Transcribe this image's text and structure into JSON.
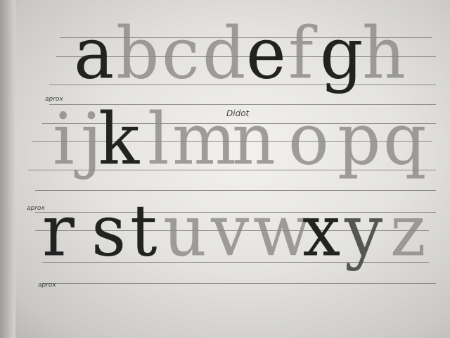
{
  "rows": [
    {
      "letters": [
        "a",
        "b",
        "c",
        "d",
        "e",
        "f",
        "g",
        "h"
      ],
      "shading": [
        "dark",
        "light",
        "light",
        "light",
        "dark",
        "light",
        "dark",
        "light"
      ]
    },
    {
      "letters": [
        "i",
        "j",
        "k",
        "l",
        "m",
        "n",
        "o",
        "p",
        "q"
      ],
      "shading": [
        "light",
        "light",
        "dark",
        "light",
        "light",
        "light",
        "light",
        "light",
        "light"
      ]
    },
    {
      "letters": [
        "r",
        "s",
        "t",
        "u",
        "v",
        "w",
        "x",
        "y",
        "z"
      ],
      "shading": [
        "dark",
        "dark",
        "dark",
        "light",
        "light",
        "light",
        "dark",
        "med",
        "light"
      ]
    }
  ],
  "annotations": {
    "font_name": "Didot",
    "approx_1": "aprox",
    "approx_2": "aprox",
    "approx_3": "aprox"
  }
}
